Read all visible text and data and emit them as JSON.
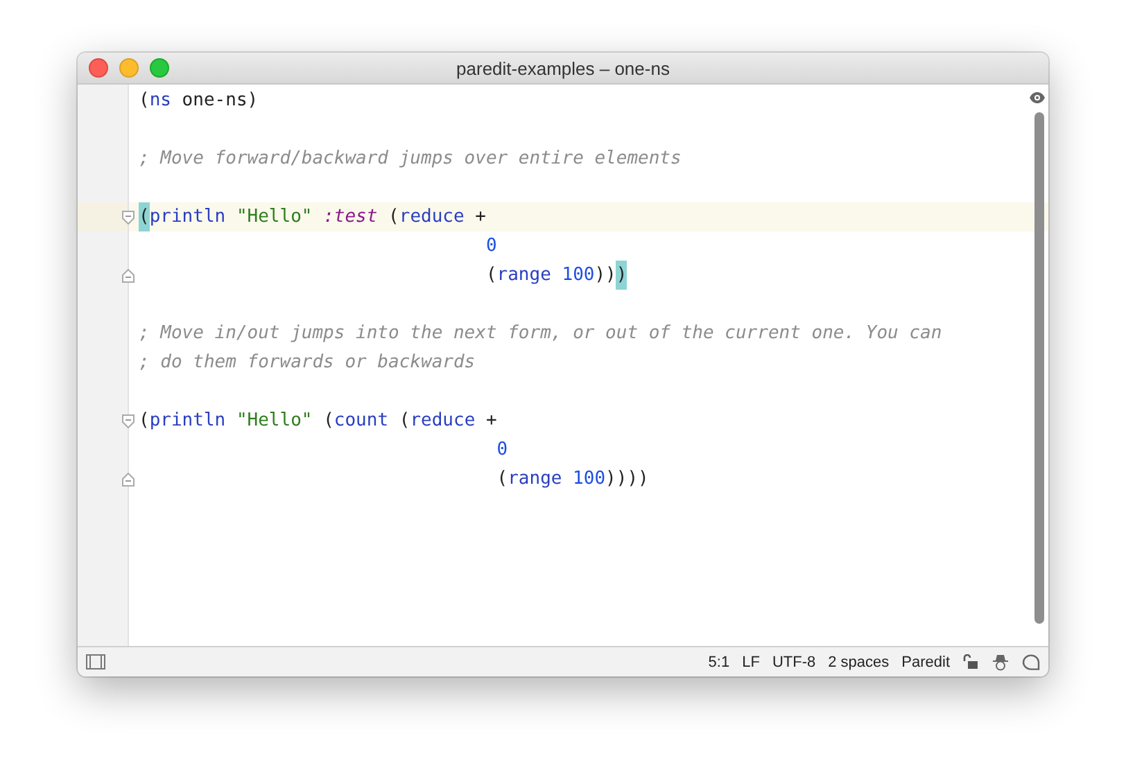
{
  "window": {
    "title": "paredit-examples – one-ns"
  },
  "editor": {
    "lines": [
      {
        "current": false,
        "continuation": false,
        "fold_start": false,
        "fold_end": false,
        "tokens": [
          {
            "text": "(",
            "kind": "plain",
            "matched": false
          },
          {
            "text": "ns",
            "kind": "fn",
            "matched": false
          },
          {
            "text": " one-ns)",
            "kind": "plain",
            "matched": false
          }
        ]
      },
      {
        "current": false,
        "continuation": false,
        "fold_start": false,
        "fold_end": false
      },
      {
        "current": false,
        "continuation": false,
        "fold_start": false,
        "fold_end": false,
        "tokens": [
          {
            "text": "; Move forward/backward jumps over entire elements",
            "kind": "comment",
            "matched": false
          }
        ]
      },
      {
        "current": false,
        "continuation": false,
        "fold_start": false,
        "fold_end": false
      },
      {
        "current": true,
        "continuation": false,
        "fold_start": true,
        "fold_end": false,
        "tokens": [
          {
            "text": "(",
            "kind": "plain",
            "matched": true
          },
          {
            "text": "println",
            "kind": "fn",
            "matched": false
          },
          {
            "text": " \"Hello\"",
            "kind": "string",
            "matched": false
          },
          {
            "text": " :test",
            "kind": "keyword",
            "matched": false
          },
          {
            "text": " (",
            "kind": "plain",
            "matched": false
          },
          {
            "text": "reduce",
            "kind": "fn",
            "matched": false
          },
          {
            "text": " +",
            "kind": "plain",
            "matched": false
          }
        ]
      },
      {
        "current": false,
        "continuation": true,
        "fold_start": false,
        "fold_end": false,
        "tokens": [
          {
            "text": "0",
            "kind": "number",
            "matched": false
          }
        ]
      },
      {
        "current": false,
        "continuation": true,
        "fold_start": false,
        "fold_end": true,
        "tokens": [
          {
            "text": "(",
            "kind": "plain",
            "matched": false
          },
          {
            "text": "range",
            "kind": "fn",
            "matched": false
          },
          {
            "text": " 100",
            "kind": "number",
            "matched": false
          },
          {
            "text": "))",
            "kind": "plain",
            "matched": false
          },
          {
            "text": ")",
            "kind": "plain",
            "matched": true
          }
        ]
      },
      {
        "current": false,
        "continuation": false,
        "fold_start": false,
        "fold_end": false
      },
      {
        "current": false,
        "continuation": false,
        "fold_start": false,
        "fold_end": false,
        "tokens": [
          {
            "text": "; Move in/out jumps into the next form, or out of the current one. You can",
            "kind": "comment",
            "matched": false
          }
        ]
      },
      {
        "current": false,
        "continuation": false,
        "fold_start": false,
        "fold_end": false,
        "tokens": [
          {
            "text": "; do them forwards or backwards",
            "kind": "comment",
            "matched": false
          }
        ]
      },
      {
        "current": false,
        "continuation": false,
        "fold_start": false,
        "fold_end": false
      },
      {
        "current": false,
        "continuation": false,
        "fold_start": true,
        "fold_end": false,
        "tokens": [
          {
            "text": "(",
            "kind": "plain",
            "matched": false
          },
          {
            "text": "println",
            "kind": "fn",
            "matched": false
          },
          {
            "text": " \"Hello\"",
            "kind": "string",
            "matched": false
          },
          {
            "text": " (",
            "kind": "plain",
            "matched": false
          },
          {
            "text": "count",
            "kind": "fn",
            "matched": false
          },
          {
            "text": " (",
            "kind": "plain",
            "matched": false
          },
          {
            "text": "reduce",
            "kind": "fn",
            "matched": false
          },
          {
            "text": " +",
            "kind": "plain",
            "matched": false
          }
        ]
      },
      {
        "current": false,
        "continuation": true,
        "fold_start": false,
        "fold_end": false,
        "tokens": [
          {
            "text": "0",
            "kind": "number",
            "matched": false
          }
        ]
      },
      {
        "current": false,
        "continuation": true,
        "fold_start": false,
        "fold_end": true,
        "tokens": [
          {
            "text": "(",
            "kind": "plain",
            "matched": false
          },
          {
            "text": "range",
            "kind": "fn",
            "matched": false
          },
          {
            "text": " 100",
            "kind": "number",
            "matched": false
          },
          {
            "text": "))))",
            "kind": "plain",
            "matched": false
          }
        ]
      }
    ]
  },
  "status_bar": {
    "items": [
      "5:1",
      "LF",
      "UTF-8",
      "2 spaces",
      "Paredit"
    ]
  }
}
